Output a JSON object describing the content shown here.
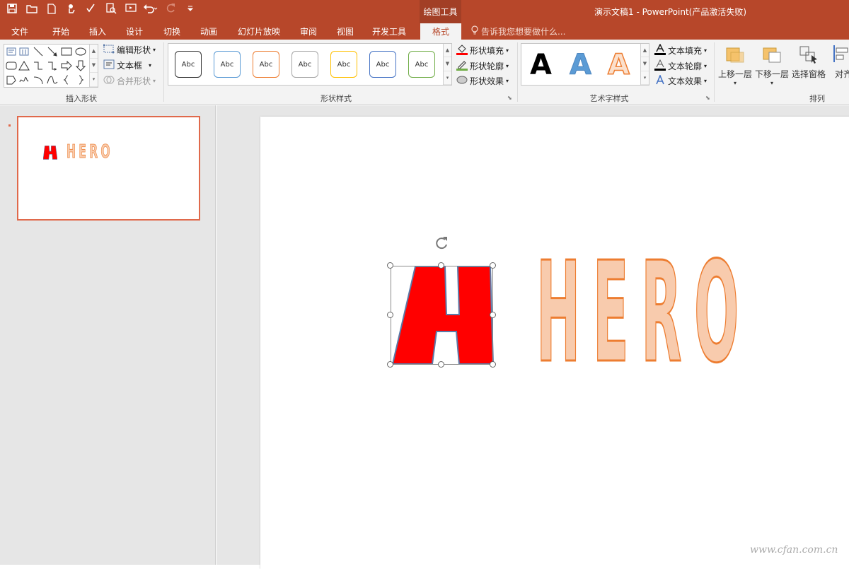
{
  "app": {
    "title": "演示文稿1 - PowerPoint(产品激活失败)",
    "context_group": "绘图工具",
    "tell_me": "告诉我您想要做什么..."
  },
  "tabs": [
    {
      "label": "文件"
    },
    {
      "label": "开始"
    },
    {
      "label": "插入"
    },
    {
      "label": "设计"
    },
    {
      "label": "切换"
    },
    {
      "label": "动画"
    },
    {
      "label": "幻灯片放映"
    },
    {
      "label": "审阅"
    },
    {
      "label": "视图"
    },
    {
      "label": "开发工具"
    },
    {
      "label": "格式",
      "active": true
    }
  ],
  "ribbon": {
    "insert_shapes": {
      "label": "插入形状",
      "edit_shape": "编辑形状",
      "text_box": "文本框",
      "merge_shapes": "合并形状"
    },
    "shape_styles": {
      "label": "形状样式",
      "swatches": [
        {
          "text": "Abc",
          "color": "#333333"
        },
        {
          "text": "Abc",
          "color": "#5b9bd5"
        },
        {
          "text": "Abc",
          "color": "#ed7d31"
        },
        {
          "text": "Abc",
          "color": "#a5a5a5"
        },
        {
          "text": "Abc",
          "color": "#ffc000"
        },
        {
          "text": "Abc",
          "color": "#4472c4"
        },
        {
          "text": "Abc",
          "color": "#70ad47"
        }
      ],
      "fill": "形状填充",
      "outline": "形状轮廓",
      "effects": "形状效果"
    },
    "wordart": {
      "label": "艺术字样式",
      "samples": [
        "A",
        "A",
        "A"
      ],
      "text_fill": "文本填充",
      "text_outline": "文本轮廓",
      "text_effects": "文本效果"
    },
    "arrange": {
      "label": "排列",
      "bring_forward": "上移一层",
      "send_backward": "下移一层",
      "selection_pane": "选择窗格",
      "align": "对齐"
    }
  },
  "slide": {
    "letter_h": "H",
    "text": "HERO",
    "thumb_text": "HERO",
    "colors": {
      "fill_red": "#ff0000",
      "letter_fill": "#f8cbad",
      "letter_outline": "#ed7d31",
      "accent": "#b7472a"
    }
  },
  "watermark": "www.cfan.com.cn"
}
